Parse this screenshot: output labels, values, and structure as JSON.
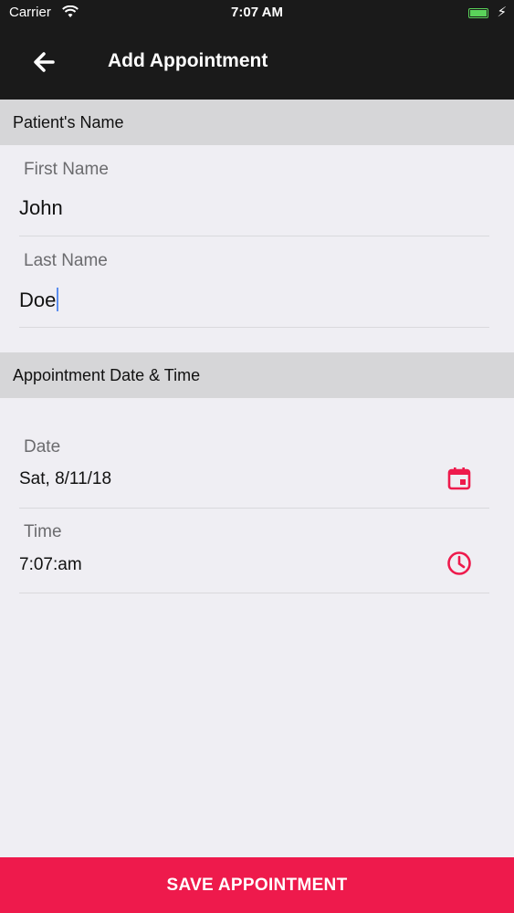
{
  "status_bar": {
    "carrier": "Carrier",
    "time": "7:07 AM",
    "battery_level": 1.0
  },
  "nav": {
    "title": "Add Appointment",
    "back_icon": "arrow-left-icon"
  },
  "patient_section": {
    "header": "Patient's Name",
    "first_name": {
      "label": "First Name",
      "value": "John"
    },
    "last_name": {
      "label": "Last Name",
      "value": "Doe"
    }
  },
  "appointment_section": {
    "header": "Appointment Date & Time",
    "date": {
      "label": "Date",
      "value": "Sat, 8/11/18",
      "icon": "calendar-icon"
    },
    "time": {
      "label": "Time",
      "value": "7:07:am",
      "icon": "clock-icon"
    }
  },
  "save_button": {
    "label": "SAVE APPOINTMENT"
  },
  "colors": {
    "accent": "#ee1a4c",
    "nav_bg": "#1a1a1a",
    "section_bg": "#d6d6d8",
    "page_bg": "#efeef3"
  }
}
